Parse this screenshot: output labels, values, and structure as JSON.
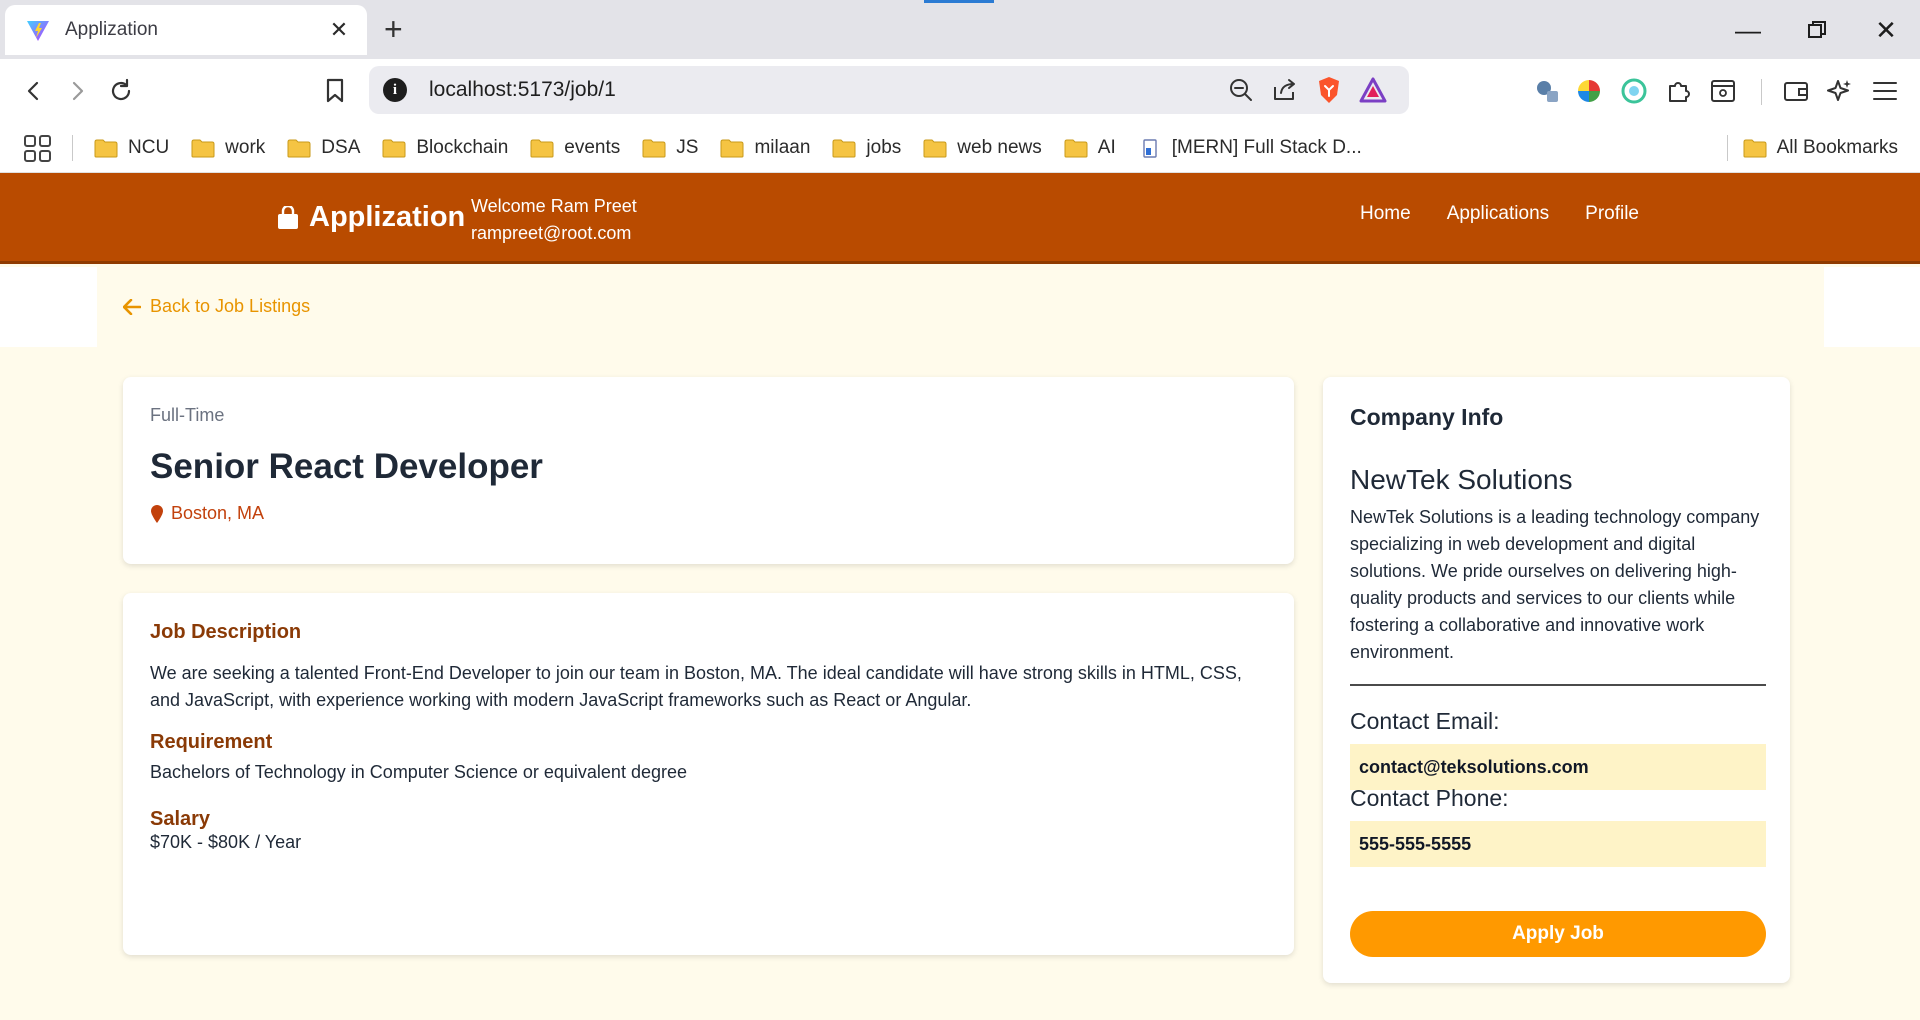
{
  "browser": {
    "tab_title": "Applization",
    "url": "localhost:5173/job/1",
    "bookmarks": [
      "NCU",
      "work",
      "DSA",
      "Blockchain",
      "events",
      "JS",
      "milaan",
      "jobs",
      "web news",
      "AI",
      "[MERN] Full Stack D..."
    ],
    "all_bookmarks": "All Bookmarks"
  },
  "navbar": {
    "brand": "Applization",
    "welcome_line": "Welcome Ram Preet",
    "email": "rampreet@root.com",
    "links": [
      "Home",
      "Applications",
      "Profile"
    ]
  },
  "back_link": "Back to Job Listings",
  "job": {
    "type": "Full-Time",
    "title": "Senior React Developer",
    "location": "Boston, MA",
    "description_heading": "Job Description",
    "description": "We are seeking a talented Front-End Developer to join our team in Boston, MA. The ideal candidate will have strong skills in HTML, CSS, and JavaScript, with experience working with modern JavaScript frameworks such as React or Angular.",
    "requirement_heading": "Requirement",
    "requirement": "Bachelors of Technology in Computer Science or equivalent degree",
    "salary_heading": "Salary",
    "salary": "$70K - $80K / Year"
  },
  "company": {
    "heading": "Company Info",
    "name": "NewTek Solutions",
    "description": "NewTek Solutions is a leading technology company specializing in web development and digital solutions. We pride ourselves on delivering high-quality products and services to our clients while fostering a collaborative and innovative work environment.",
    "email_label": "Contact Email:",
    "email": "contact@teksolutions.com",
    "phone_label": "Contact Phone:",
    "phone": "555-555-5555",
    "apply_label": "Apply Job"
  },
  "colors": {
    "navbar": "#b94b00",
    "page_bg": "#fffbeb",
    "accent": "#ff9900",
    "section_heading": "#8a3a06",
    "contact_bg": "#fef3c7"
  }
}
